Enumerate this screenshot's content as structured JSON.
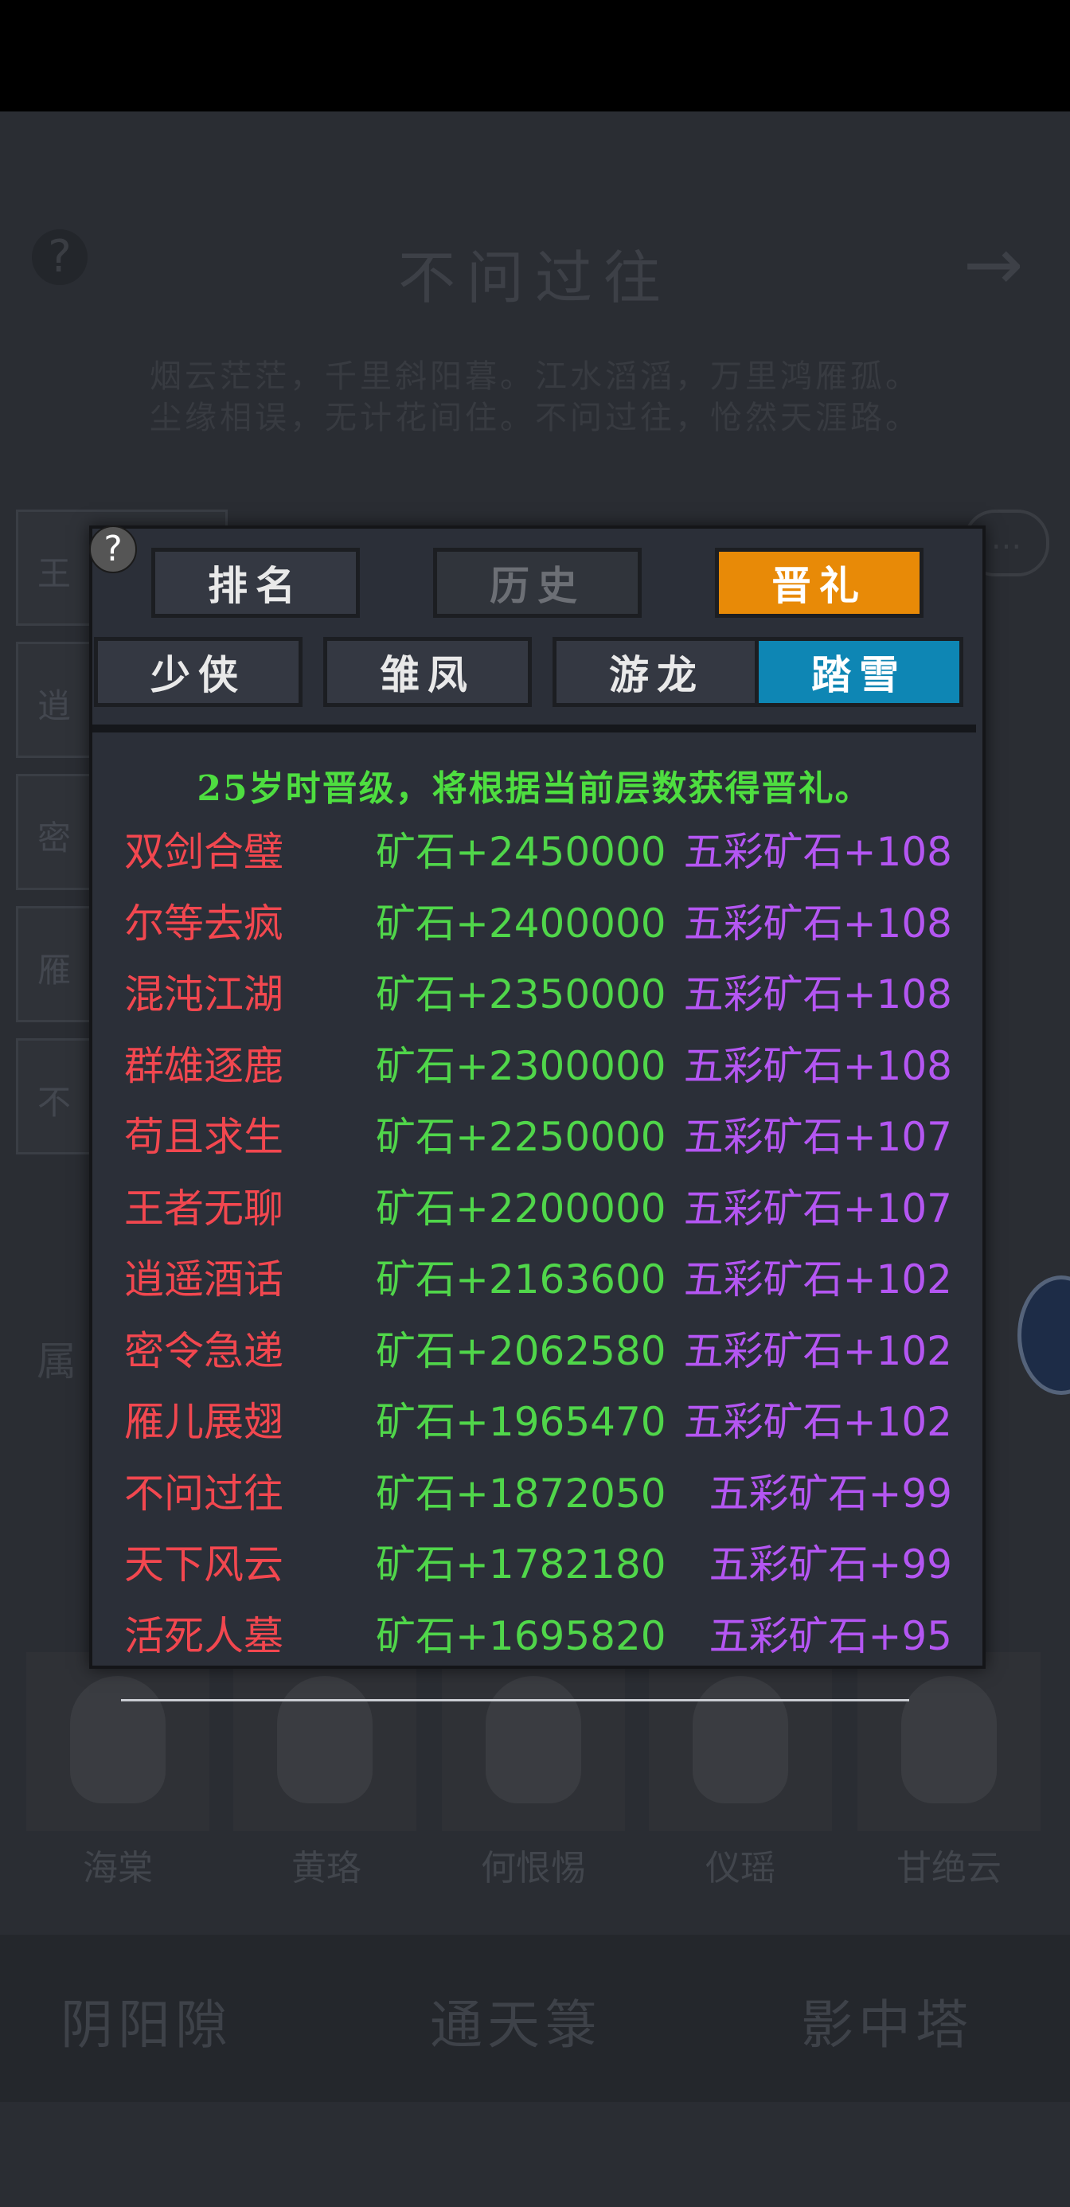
{
  "background": {
    "help_icon": "?",
    "title": "不问过往",
    "next_icon": "→",
    "poem_line_1": "烟云茫茫，千里斜阳暮。江水滔滔，万里鸿雁孤。",
    "poem_line_2": "尘缘相误，无计花间住。不问过往，怆然天涯路。",
    "side_buttons": [
      "王",
      "逍",
      "密",
      "雁",
      "不"
    ],
    "chat_icon": "...",
    "attr_label": "属",
    "portraits": [
      {
        "name": "海棠"
      },
      {
        "name": "黄珞"
      },
      {
        "name": "何恨惕"
      },
      {
        "name": "仪瑶"
      },
      {
        "name": "甘绝云"
      }
    ],
    "bottom_nav": [
      "阴阳隙",
      "通天箓",
      "影中塔"
    ]
  },
  "modal": {
    "help_icon": "?",
    "tabs_main": [
      {
        "label": "排名",
        "state": "normal"
      },
      {
        "label": "历史",
        "state": "disabled"
      },
      {
        "label": "晋礼",
        "state": "active"
      }
    ],
    "tabs_sub": [
      {
        "label": "少侠",
        "state": "normal"
      },
      {
        "label": "雏凤",
        "state": "normal"
      },
      {
        "label": "游龙",
        "state": "normal"
      },
      {
        "label": "踏雪",
        "state": "active"
      }
    ],
    "note": "25岁时晋级，将根据当前层数获得晋礼。",
    "rewards": [
      {
        "tier": "双剑合璧",
        "ore": "矿石+2450000",
        "color_ore": "五彩矿石+108"
      },
      {
        "tier": "尔等去疯",
        "ore": "矿石+2400000",
        "color_ore": "五彩矿石+108"
      },
      {
        "tier": "混沌江湖",
        "ore": "矿石+2350000",
        "color_ore": "五彩矿石+108"
      },
      {
        "tier": "群雄逐鹿",
        "ore": "矿石+2300000",
        "color_ore": "五彩矿石+108"
      },
      {
        "tier": "苟且求生",
        "ore": "矿石+2250000",
        "color_ore": "五彩矿石+107"
      },
      {
        "tier": "王者无聊",
        "ore": "矿石+2200000",
        "color_ore": "五彩矿石+107"
      },
      {
        "tier": "逍遥酒话",
        "ore": "矿石+2163600",
        "color_ore": "五彩矿石+102"
      },
      {
        "tier": "密令急递",
        "ore": "矿石+2062580",
        "color_ore": "五彩矿石+102"
      },
      {
        "tier": "雁儿展翅",
        "ore": "矿石+1965470",
        "color_ore": "五彩矿石+102"
      },
      {
        "tier": "不问过往",
        "ore": "矿石+1872050",
        "color_ore": "五彩矿石+99"
      },
      {
        "tier": "天下风云",
        "ore": "矿石+1782180",
        "color_ore": "五彩矿石+99"
      },
      {
        "tier": "活死人墓",
        "ore": "矿石+1695820",
        "color_ore": "五彩矿石+95"
      }
    ]
  },
  "colors": {
    "tier_name": "#f2474f",
    "ore": "#50d64a",
    "color_ore": "#b456f2",
    "active_main_tab": "#e88a07",
    "active_sub_tab": "#0e86b4"
  }
}
